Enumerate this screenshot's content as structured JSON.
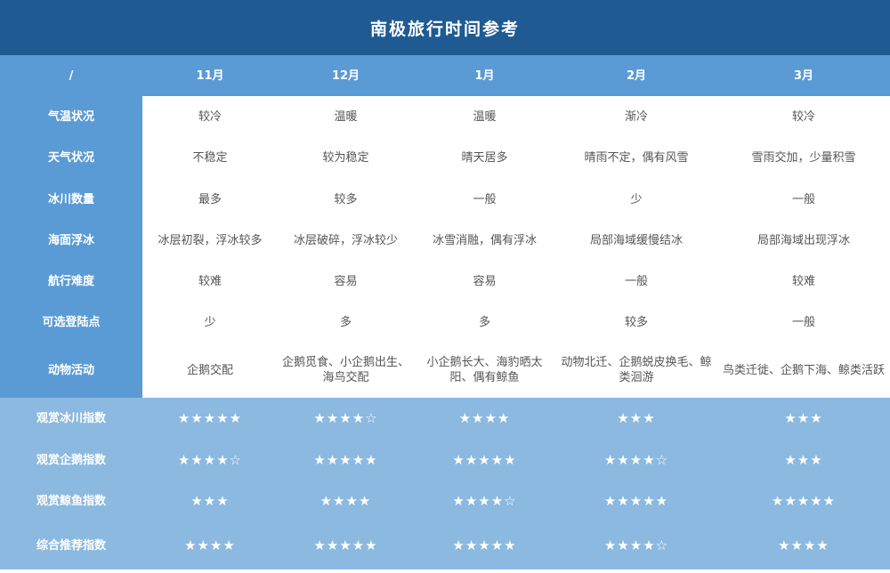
{
  "title": "南极旅行时间参考",
  "columns": [
    "/",
    "11月",
    "12月",
    "1月",
    "2月",
    "3月"
  ],
  "rows": [
    {
      "label": "气温状况",
      "values": [
        "较冷",
        "温暖",
        "温暖",
        "渐冷",
        "较冷"
      ]
    },
    {
      "label": "天气状况",
      "values": [
        "不稳定",
        "较为稳定",
        "晴天居多",
        "晴雨不定，偶有风雪",
        "雪雨交加，少量积雪"
      ]
    },
    {
      "label": "冰川数量",
      "values": [
        "最多",
        "较多",
        "一般",
        "少",
        "一般"
      ]
    },
    {
      "label": "海面浮冰",
      "values": [
        "冰层初裂，浮冰较多",
        "冰层破碎，浮冰较少",
        "冰雪消融，偶有浮冰",
        "局部海域缓慢结冰",
        "局部海域出现浮冰"
      ]
    },
    {
      "label": "航行难度",
      "values": [
        "较难",
        "容易",
        "容易",
        "一般",
        "较难"
      ]
    },
    {
      "label": "可选登陆点",
      "values": [
        "少",
        "多",
        "多",
        "较多",
        "一般"
      ]
    },
    {
      "label": "动物活动",
      "values": [
        "企鹅交配",
        "企鹅觅食、小企鹅出生、海鸟交配",
        "小企鹅长大、海豹晒太阳、偶有鲸鱼",
        "动物北迁、企鹅蜕皮换毛、鲸类洄游",
        "鸟类迁徙、企鹅下海、鲸类活跃"
      ]
    }
  ],
  "indices": [
    {
      "label": "观赏冰川指数",
      "values": [
        "★★★★★",
        "★★★★☆",
        "★★★★",
        "★★★",
        "★★★"
      ]
    },
    {
      "label": "观赏企鹅指数",
      "values": [
        "★★★★☆",
        "★★★★★",
        "★★★★★",
        "★★★★☆",
        "★★★"
      ]
    },
    {
      "label": "观赏鲸鱼指数",
      "values": [
        "★★★",
        "★★★★",
        "★★★★☆",
        "★★★★★",
        "★★★★★"
      ]
    },
    {
      "label": "综合推荐指数",
      "values": [
        "★★★★",
        "★★★★★",
        "★★★★★",
        "★★★★☆",
        "★★★★"
      ]
    }
  ],
  "colors": {
    "title_bg": "#1f5a92",
    "header_bg": "#5b9bd5",
    "index_bg": "#8cb9df",
    "body_text": "#555555"
  }
}
